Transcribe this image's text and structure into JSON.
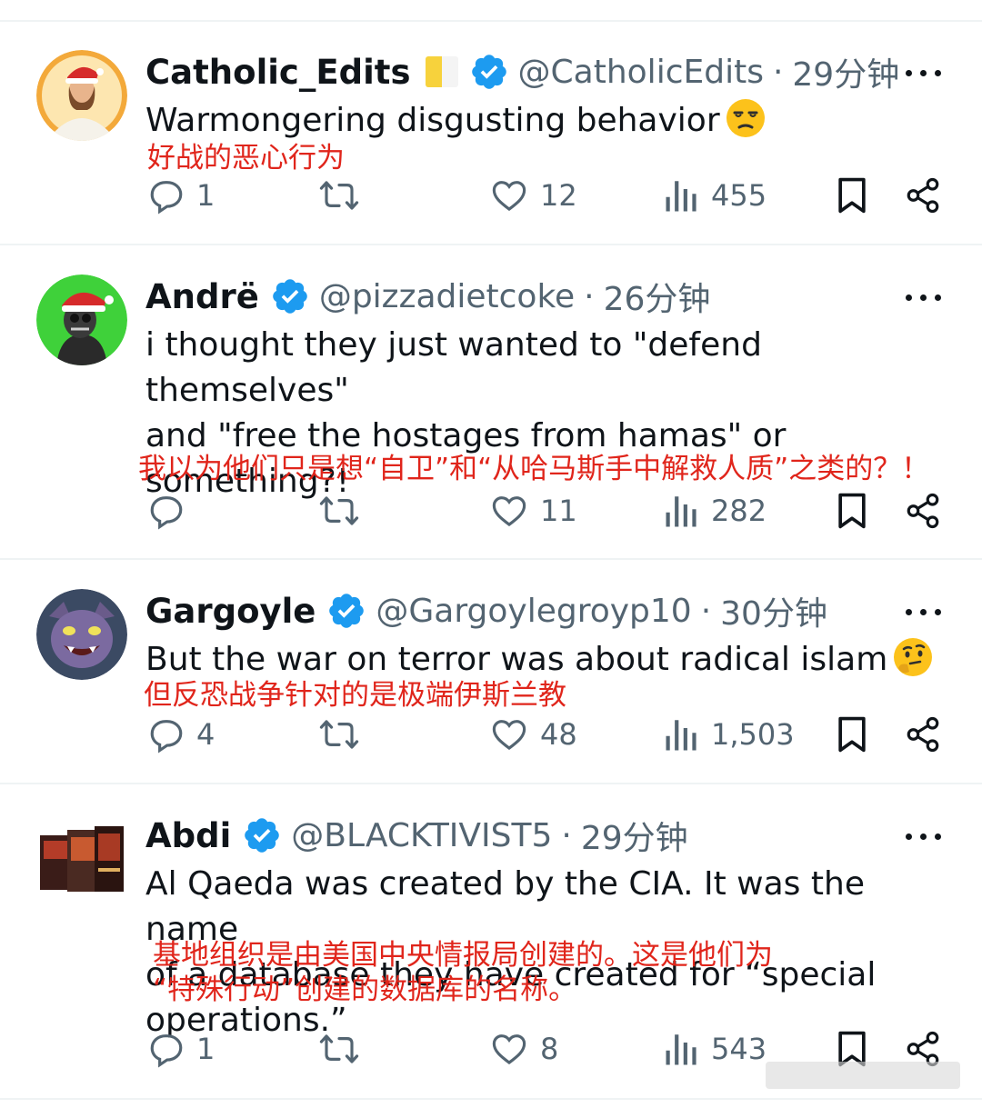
{
  "posts": [
    {
      "name": "Catholic_Edits",
      "handle": "@CatholicEdits",
      "sep": "·",
      "time": "29分钟",
      "text": "Warmongering disgusting behavior",
      "translation": "好战的恶心行为",
      "avatar": "jesus-santa-avatar",
      "flag": "vatican-flag",
      "emoji": "unamused-face",
      "replies": "1",
      "reposts": "",
      "likes": "12",
      "views": "455"
    },
    {
      "name": "Andrë",
      "handle": "@pizzadietcoke",
      "sep": "·",
      "time": "26分钟",
      "text_lines": [
        "i thought they just wanted to \"defend themselves\"",
        "and \"free the hostages from hamas\" or",
        "something?!"
      ],
      "translation": "我以为他们只是想“自卫”和“从哈马斯手中解救人质”之类的？！",
      "avatar": "skeleton-santa-avatar",
      "replies": "",
      "reposts": "",
      "likes": "11",
      "views": "282"
    },
    {
      "name": "Gargoyle",
      "handle": "@Gargoylegroyp10",
      "sep": "·",
      "time": "30分钟",
      "text": "But the war on terror was about radical islam",
      "translation": "但反恐战争针对的是极端伊斯兰教",
      "avatar": "gargoyle-avatar",
      "emoji": "thinking-face",
      "replies": "4",
      "reposts": "",
      "likes": "48",
      "views": "1,503"
    },
    {
      "name": "Abdi",
      "handle": "@BLACKTIVIST5",
      "sep": "·",
      "time": "29分钟",
      "text_lines": [
        "Al Qaeda was created by the CIA. It was the name",
        "of a database they have created for “special",
        "operations.”"
      ],
      "translation_lines": [
        "基地组织是由美国中央情报局创建的。这是他们为",
        "“特殊行动”创建的数据库的名称。"
      ],
      "avatar": "book-covers-avatar",
      "replies": "1",
      "reposts": "",
      "likes": "8",
      "views": "543"
    }
  ],
  "colors": {
    "text": "#0f1419",
    "secondary": "#536471",
    "verified": "#1d9bf0",
    "translation": "#e0251b",
    "separator": "#eff3f4"
  },
  "icons": [
    "reply-icon",
    "repost-icon",
    "like-icon",
    "views-icon",
    "bookmark-icon",
    "share-icon",
    "more-icon",
    "verified-badge-icon"
  ]
}
